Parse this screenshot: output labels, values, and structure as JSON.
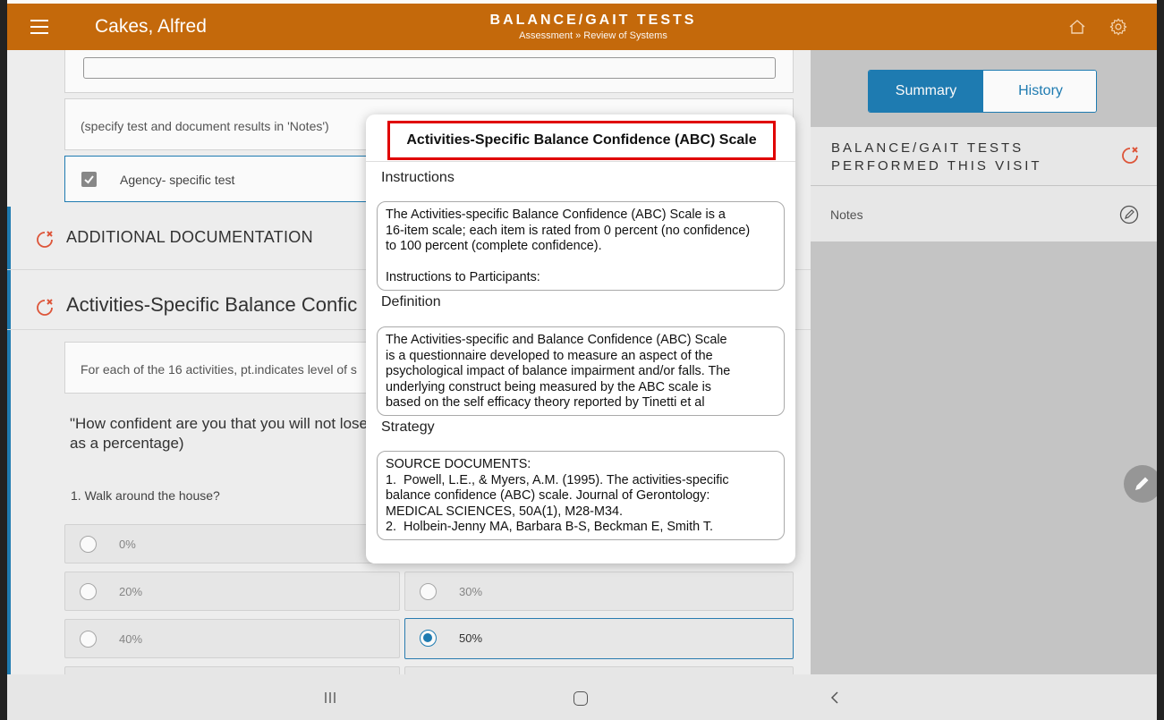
{
  "header": {
    "patient_name": "Cakes, Alfred",
    "title": "BALANCE/GAIT TESTS",
    "breadcrumb": "Assessment » Review of Systems",
    "brand_color": "#c4690b"
  },
  "left": {
    "specify_text": "(specify test and document results in 'Notes')",
    "agency_test_label": "Agency- specific test",
    "additional_doc_title": "ADDITIONAL DOCUMENTATION",
    "abc_title": "Activities-Specific Balance Confic",
    "instruction_text": "For each of the 16 activities, pt.indicates level of s",
    "question_line1": "\"How confident are you that you will not lose",
    "question_line2": "as a percentage)",
    "item1": "1. Walk around the house?",
    "options": [
      "0%",
      "20%",
      "30%",
      "40%",
      "50%"
    ],
    "selected_option": "50%"
  },
  "right_panel": {
    "tab_summary": "Summary",
    "tab_history": "History",
    "section_title": "BALANCE/GAIT TESTS PERFORMED THIS VISIT",
    "notes_label": "Notes",
    "accent_color": "#1f7eb5"
  },
  "modal": {
    "title": "Activities-Specific Balance Confidence (ABC) Scale",
    "instructions_label": "Instructions",
    "instructions_text": "The Activities-specific Balance Confidence (ABC) Scale is a\n16-item scale; each item is rated from 0 percent (no confidence)\nto 100 percent (complete confidence).\n\nInstructions to Participants:",
    "definition_label": "Definition",
    "definition_text": "The Activities-specific and Balance Confidence (ABC) Scale\nis a questionnaire developed to measure an aspect of the\npsychological impact of balance impairment and/or falls. The\nunderlying construct being measured by the ABC scale is\nbased on the self efficacy theory reported by Tinetti et al",
    "strategy_label": "Strategy",
    "strategy_text": "SOURCE DOCUMENTS:\n1.  Powell, L.E., & Myers, A.M. (1995). The activities-specific\nbalance confidence (ABC) scale. Journal of Gerontology:\nMEDICAL SCIENCES, 50A(1), M28-M34.\n2.  Holbein-Jenny MA, Barbara B-S, Beckman E, Smith T."
  },
  "icons": [
    "menu-icon",
    "home-icon",
    "gear-icon",
    "refresh-x-icon",
    "edit-icon",
    "pencil-fab-icon",
    "nav-recent-icon",
    "nav-home-icon",
    "nav-back-icon",
    "check-icon"
  ]
}
